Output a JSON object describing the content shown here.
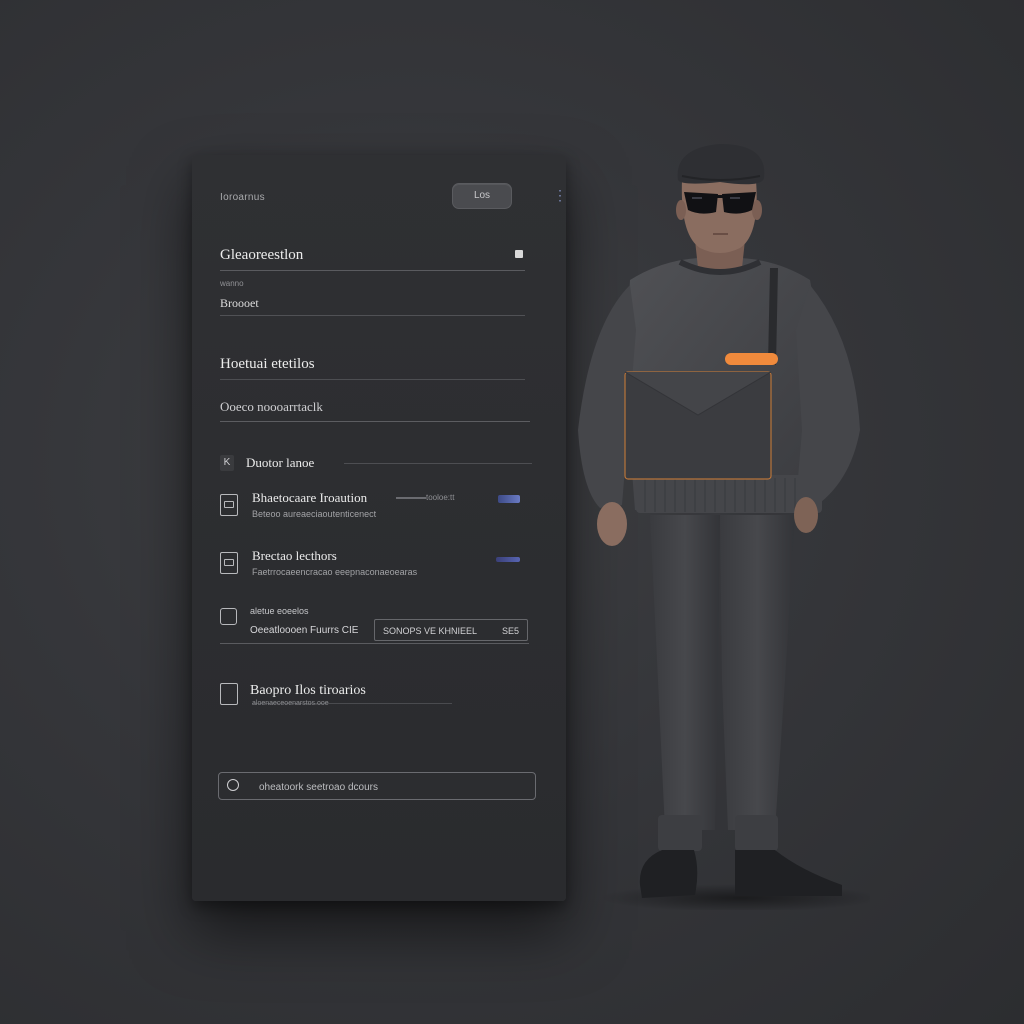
{
  "panel": {
    "caption": "Ioroarnus",
    "pill_label": "Los",
    "kebab_icon": "kebab-icon",
    "title_field": "Gleaoreestlon",
    "field_label": "wanno",
    "field_value": "Broooet",
    "section_heading": "Hoetuai etetilos",
    "section_input_value": "Ooeco noooarrtaclk",
    "list_heading": {
      "chip": "K",
      "label": "Duotor lanoe"
    },
    "items": [
      {
        "title": "Bhaetocaare Iroaution",
        "meta": "tooloe:tt",
        "subtitle": "Beteoo aureaeciaoutenticenect",
        "icon": "document-icon"
      },
      {
        "title": "Brectao lecthors",
        "meta": "",
        "subtitle": "Faetrrocaeencracao eeepnaconaeoearas",
        "icon": "document-icon"
      }
    ],
    "split_row": {
      "label": "aletue eoeelos",
      "left_text": "Oeeatloooen Fuurrs CIE",
      "right_text_1": "SONOPS VE KHNIEEL",
      "right_text_2": "SE5",
      "icon": "refresh-icon"
    },
    "bottom_item": {
      "title": "Baopro Ilos tiroarios",
      "subtitle": "aloenaeceoenarstos.ooe",
      "icon": "edit-icon"
    },
    "search": {
      "placeholder": "oheatoork seetroao dcours",
      "icon": "search-icon"
    }
  },
  "colors": {
    "background": "#353639",
    "panel": "#2d2e31",
    "accent_orange": "#f08a3c",
    "accent_blue": "#5a6cc0"
  }
}
